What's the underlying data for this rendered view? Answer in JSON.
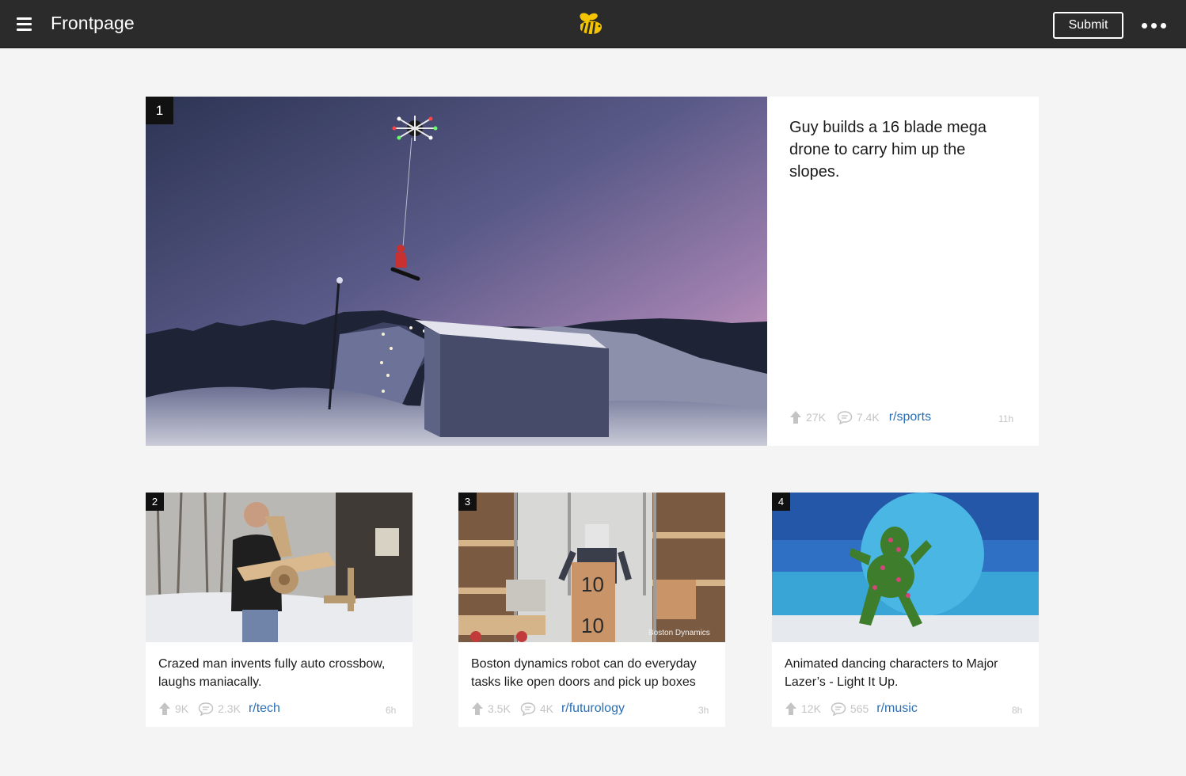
{
  "header": {
    "title": "Frontpage",
    "submit_label": "Submit",
    "menu_icon": "hamburger-icon",
    "logo_icon": "bee-logo",
    "more_icon": "more-dots-icon",
    "logo_color": "#f5c400"
  },
  "posts": [
    {
      "rank": "1",
      "title": "Guy builds a 16 blade mega drone to carry him up the slopes.",
      "upvotes": "27K",
      "comments": "7.4K",
      "subreddit": "r/sports",
      "time": "11h"
    },
    {
      "rank": "2",
      "title": "Crazed man invents fully auto crossbow, laughs maniacally.",
      "upvotes": "9K",
      "comments": "2.3K",
      "subreddit": "r/tech",
      "time": "6h"
    },
    {
      "rank": "3",
      "title": "Boston dynamics robot can do everyday tasks like open doors and pick up boxes",
      "upvotes": "3.5K",
      "comments": "4K",
      "subreddit": "r/futurology",
      "time": "3h",
      "image_watermark": "Boston Dynamics"
    },
    {
      "rank": "4",
      "title": "Animated dancing characters to Major Lazer’s - Light It Up.",
      "upvotes": "12K",
      "comments": "565",
      "subreddit": "r/music",
      "time": "8h"
    }
  ]
}
